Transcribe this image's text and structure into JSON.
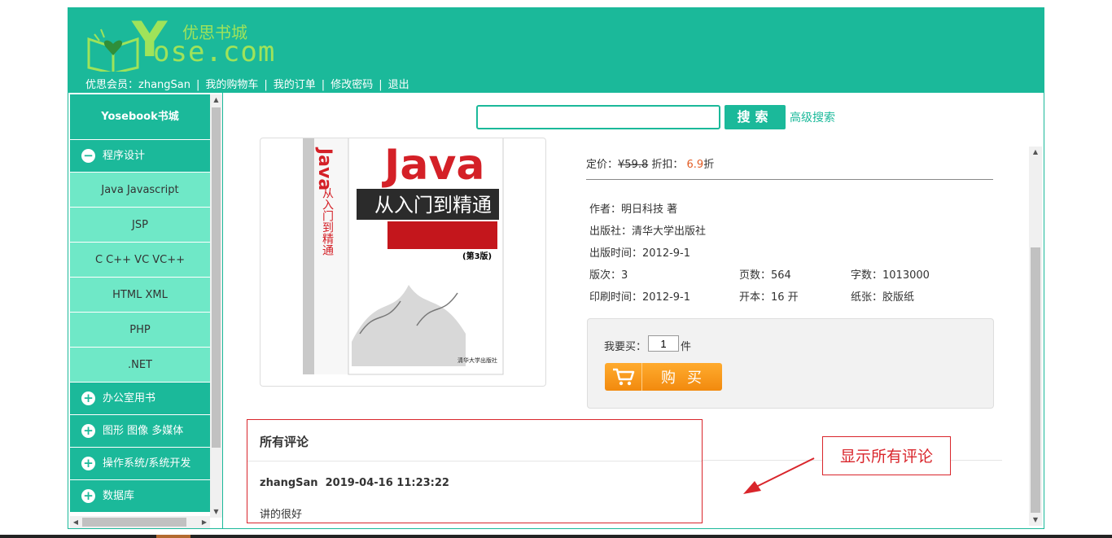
{
  "header": {
    "logo_en": "ose.com",
    "logo_y": "Y",
    "logo_cn": "优思书城",
    "nav": [
      {
        "label": "优思会员：zhangSan"
      },
      {
        "label": "我的购物车"
      },
      {
        "label": "我的订单"
      },
      {
        "label": "修改密码"
      },
      {
        "label": "退出"
      }
    ],
    "separator": "|"
  },
  "sidebar": {
    "title": "Yosebook书城",
    "categories": [
      {
        "label": "程序设计",
        "icon": "minus-circle-icon",
        "expanded": true,
        "items": [
          "Java Javascript",
          "JSP",
          "C C++ VC VC++",
          "HTML XML",
          "PHP",
          ".NET"
        ]
      },
      {
        "label": "办公室用书",
        "icon": "plus-circle-icon"
      },
      {
        "label": "图形 图像 多媒体",
        "icon": "plus-circle-icon"
      },
      {
        "label": "操作系统/系统开发",
        "icon": "plus-circle-icon"
      },
      {
        "label": "数据库",
        "icon": "plus-circle-icon"
      }
    ],
    "minus": "−",
    "plus": "+"
  },
  "search": {
    "value": "",
    "button": "搜索",
    "advanced": "高级搜索"
  },
  "book": {
    "cover_title": "Java",
    "cover_subtitle": "从入门到精通",
    "cover_edition": "(第3版)",
    "cover_side": "从入门到精通",
    "cover_publisher": "清华大学出版社",
    "price_label": "定价：",
    "price": "¥59.8",
    "discount_label": " 折扣： ",
    "discount": "6.9",
    "discount_unit": "折",
    "author": "作者：明日科技 著",
    "publisher": "出版社：清华大学出版社",
    "pub_date": "出版时间：2012-9-1",
    "edition": "版次：3",
    "pages": "页数：564",
    "words": "字数：1013000",
    "print_date": "印刷时间：2012-9-1",
    "format": "开本：16 开",
    "paper": "纸张：胶版纸"
  },
  "buy": {
    "qty_label": "我要买：",
    "qty_value": "1",
    "qty_unit": "件",
    "button": "购买"
  },
  "comments": {
    "title": "所有评论",
    "items": [
      {
        "user": "zhangSan",
        "time": "2019-04-16 11:23:22",
        "text": "讲的很好"
      }
    ]
  },
  "annotation": "显示所有评论",
  "colors": {
    "brand": "#1bb99a",
    "sidebar_sub": "#6fe8c7",
    "annotation": "#d9252b",
    "buy_button": "#f5961a"
  }
}
